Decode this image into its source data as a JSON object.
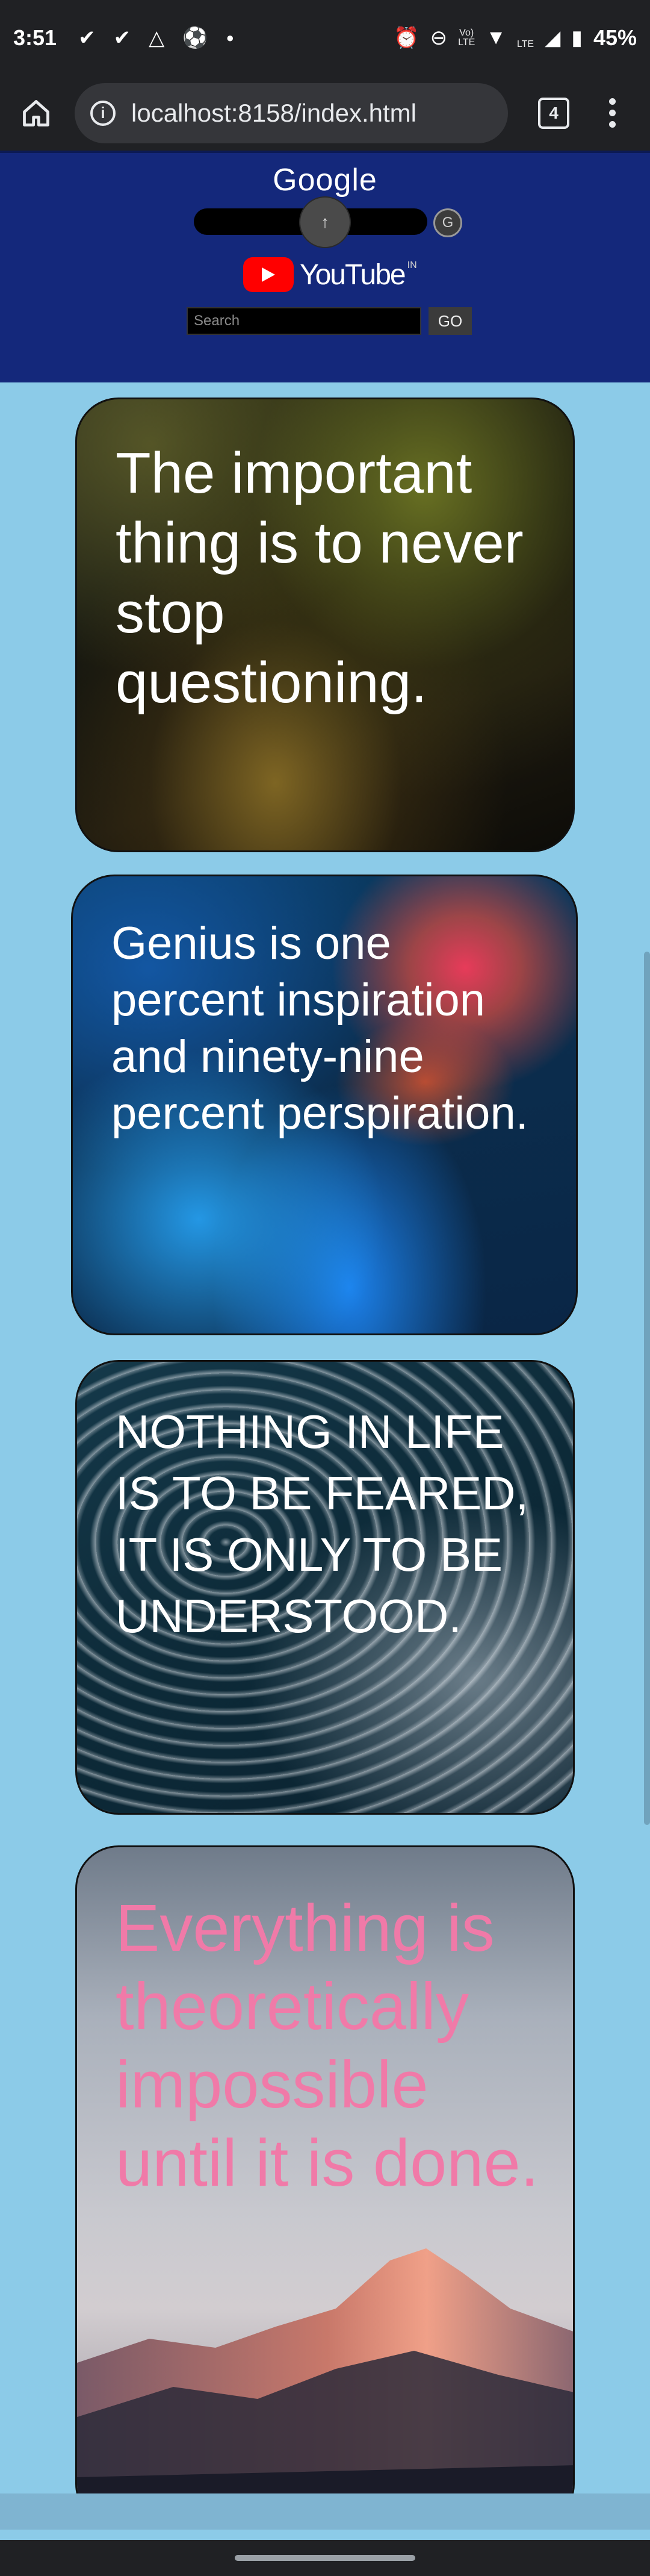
{
  "status_bar": {
    "time": "3:51",
    "left_icons": [
      "check-icon",
      "check-icon",
      "drive-icon",
      "soccer-ball-icon",
      "dot-icon"
    ],
    "network_label_top": "Vo)",
    "network_label_bottom": "LTE",
    "signal_label": "LTE",
    "battery": "45%"
  },
  "browser": {
    "url": "localhost:8158/index.html",
    "tab_count": "4"
  },
  "header": {
    "google_title": "Google",
    "upload_glyph": "↑",
    "google_button": "G",
    "youtube_word": "YouTube",
    "youtube_region": "IN",
    "youtube_search_placeholder": "Search",
    "go_label": "GO"
  },
  "quotes": [
    {
      "text": "The important thing is to never stop questioning.",
      "color": "#ffffff"
    },
    {
      "text": "Genius is one percent inspiration and ninety-nine percent perspiration.",
      "color": "#ffffff"
    },
    {
      "text": "NOTHING IN LIFE IS TO BE FEARED, IT IS ONLY TO BE UNDERSTOOD.",
      "color": "#ffffff"
    },
    {
      "text": "Everything is theoretically impossible until it is done.",
      "color": "#f07aa8"
    }
  ],
  "colors": {
    "page_background": "#8ccbe8",
    "header_background": "#14287b",
    "chrome_dark": "#202124"
  }
}
